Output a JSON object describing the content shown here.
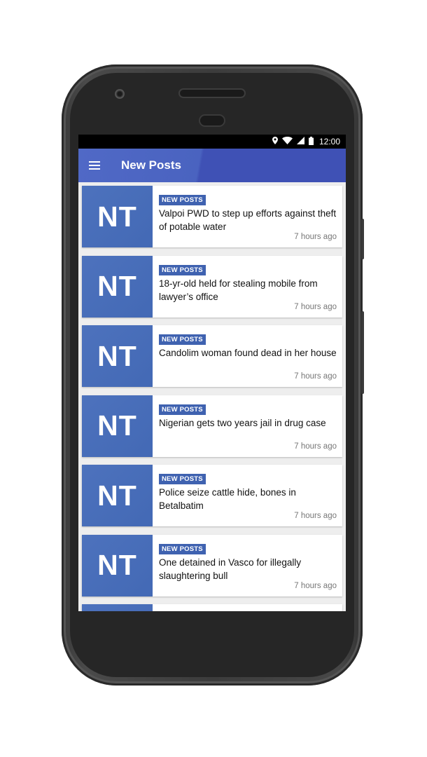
{
  "status_bar": {
    "time": "12:00"
  },
  "app_bar": {
    "title": "New Posts"
  },
  "posts": [
    {
      "thumb": "NT",
      "badge": "NEW POSTS",
      "headline": "Valpoi PWD to step up efforts against theft of potable water",
      "time": "7 hours ago"
    },
    {
      "thumb": "NT",
      "badge": "NEW POSTS",
      "headline": "18-yr-old held for stealing  mobile from lawyer’s office",
      "time": "7 hours ago"
    },
    {
      "thumb": "NT",
      "badge": "NEW POSTS",
      "headline": "Candolim woman found  dead in her house",
      "time": "7 hours ago"
    },
    {
      "thumb": "NT",
      "badge": "NEW POSTS",
      "headline": "Nigerian gets two  years jail in drug case",
      "time": "7 hours ago"
    },
    {
      "thumb": "NT",
      "badge": "NEW POSTS",
      "headline": "Police seize cattle hide, bones in Betalbatim",
      "time": "7 hours ago"
    },
    {
      "thumb": "NT",
      "badge": "NEW POSTS",
      "headline": "One detained in Vasco for illegally slaughtering bull",
      "time": "7 hours ago"
    }
  ],
  "colors": {
    "primary": "#3f51b5",
    "thumb": "#4369b5",
    "badge": "#3f62b0"
  }
}
